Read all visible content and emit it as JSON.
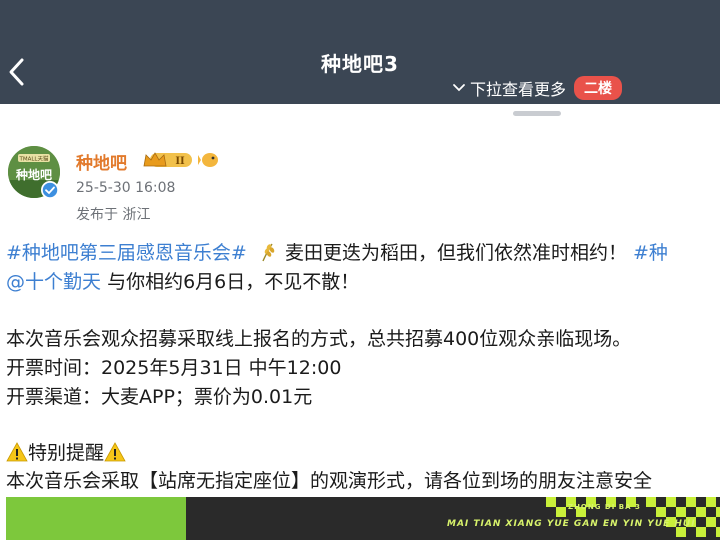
{
  "header": {
    "title": "种地吧3",
    "pull_hint": "下拉查看更多",
    "floor_badge": "二楼",
    "back_icon": "chevron-left-icon",
    "chevron_icon": "chevron-down-icon"
  },
  "post": {
    "author": "种地吧",
    "level_badge": "II",
    "time": "25-5-30 16:08",
    "location": "发布于 浙江",
    "avatar_text": "种地吧",
    "avatar_brand": "TMALL天猫",
    "lines": {
      "l1_tag": "#种地吧第三届感恩音乐会#",
      "l1_text": "麦田更迭为稻田，但我们依然准时相约！",
      "l1_tag2": "#种",
      "l2_mention": "@十个勤天",
      "l2_text": " 与你相约6月6日，不见不散！",
      "l3": "本次音乐会观众招募采取线上报名的方式，总共招募400位观众亲临现场。",
      "l4": "开票时间：2025年5月31日 中午12:00",
      "l5": "开票渠道：大麦APP；票价为0.01元",
      "l6": "特别提醒",
      "l7": "本次音乐会采取【站席无指定座位】的观演形式，请各位到场的朋友注意安全"
    }
  },
  "banner": {
    "small_text": "ZHONG DI BA 3",
    "text": "MAI TIAN XIANG YUE GAN EN YIN YUE HUI"
  },
  "colors": {
    "topbar": "#3b4654",
    "hashtag": "#3d7fd1",
    "username": "#e27a2c",
    "floor_badge": "#e9524a"
  }
}
